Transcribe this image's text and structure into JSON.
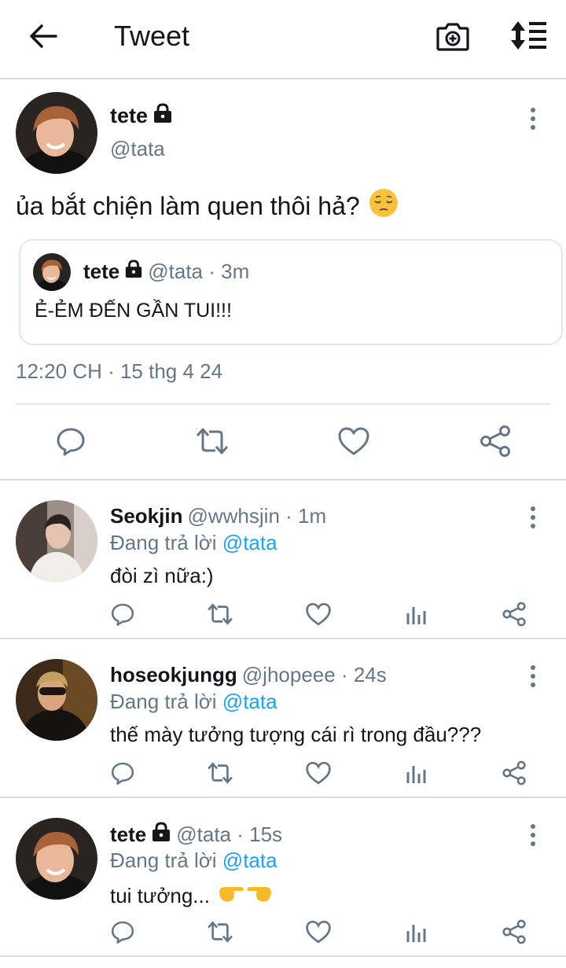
{
  "header": {
    "title": "Tweet",
    "icons": [
      "back-arrow-icon",
      "camera-plus-icon",
      "sort-icon"
    ]
  },
  "main_tweet": {
    "author_name": "tete",
    "author_handle": "@tata",
    "text": "ủa bắt chiện làm quen thôi hả?",
    "emoji": "pensive-face",
    "quoted": {
      "author_name": "tete",
      "meta": "@tata · 3m",
      "text": "Ẻ-ẺM ĐẾN GẦN TUI!!!"
    },
    "timestamp": "12:20 CH · 15 thg 4 24",
    "actions": [
      "reply-icon",
      "retweet-icon",
      "like-icon",
      "share-icon"
    ]
  },
  "replies": [
    {
      "name": "Seokjin",
      "meta": "@wwhsjin · 1m",
      "replying_prefix": "Đang trả lời",
      "replying_to": "@tata",
      "text": "đòi zì nữa:)",
      "locked": false
    },
    {
      "name": "hoseokjungg",
      "meta": "@jhopeee · 24s",
      "replying_prefix": "Đang trả lời",
      "replying_to": "@tata",
      "text": "thế mày tưởng tượng cái rì trong đầu???",
      "locked": false
    },
    {
      "name": "tete",
      "meta": "@tata · 15s",
      "replying_prefix": "Đang trả lời",
      "replying_to": "@tata",
      "text": "tui tưởng...",
      "emoji": "pointing-hands",
      "locked": true
    }
  ],
  "colors": {
    "accent": "#1da1f2",
    "secondary_text": "#657786",
    "divider": "#d9dde1"
  }
}
